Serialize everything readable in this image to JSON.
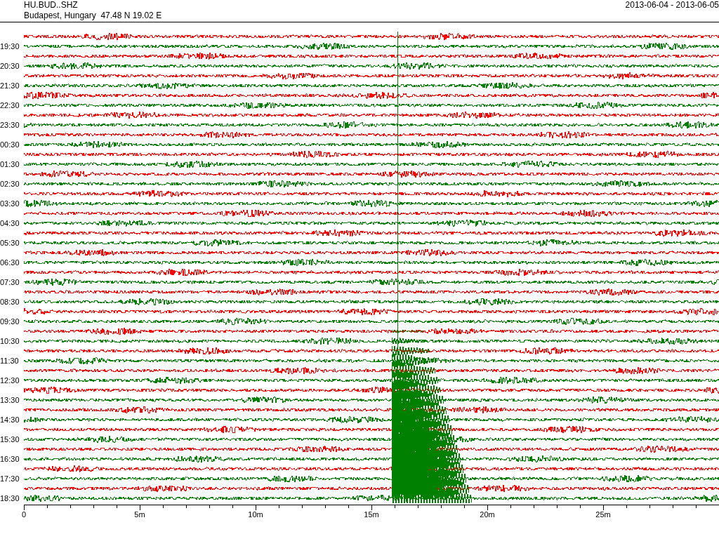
{
  "header": {
    "station": "HU.BUD..SHZ",
    "location": "Budapest, Hungary  47.48 N 19.02 E",
    "date_range": "2013-06-04 - 2013-06-05"
  },
  "traces": [
    {
      "color": "#ff0000"
    },
    {
      "label": "19:30",
      "color": "#008000"
    },
    {
      "color": "#ff0000"
    },
    {
      "label": "20:30",
      "color": "#008000"
    },
    {
      "color": "#ff0000"
    },
    {
      "label": "21:30",
      "color": "#008000"
    },
    {
      "color": "#ff0000"
    },
    {
      "label": "22:30",
      "color": "#008000"
    },
    {
      "color": "#ff0000"
    },
    {
      "label": "23:30",
      "color": "#008000"
    },
    {
      "color": "#ff0000"
    },
    {
      "label": "00:30",
      "color": "#008000"
    },
    {
      "color": "#ff0000"
    },
    {
      "label": "01:30",
      "color": "#008000"
    },
    {
      "color": "#ff0000"
    },
    {
      "label": "02:30",
      "color": "#008000"
    },
    {
      "color": "#ff0000"
    },
    {
      "label": "03:30",
      "color": "#008000"
    },
    {
      "color": "#ff0000"
    },
    {
      "label": "04:30",
      "color": "#008000"
    },
    {
      "color": "#ff0000"
    },
    {
      "label": "05:30",
      "color": "#008000"
    },
    {
      "color": "#ff0000"
    },
    {
      "label": "06:30",
      "color": "#008000"
    },
    {
      "color": "#ff0000"
    },
    {
      "label": "07:30",
      "color": "#008000"
    },
    {
      "color": "#ff0000"
    },
    {
      "label": "08:30",
      "color": "#008000"
    },
    {
      "color": "#ff0000"
    },
    {
      "label": "09:30",
      "color": "#008000"
    },
    {
      "color": "#ff0000"
    },
    {
      "label": "10:30",
      "color": "#008000"
    },
    {
      "color": "#ff0000"
    },
    {
      "label": "11:30",
      "color": "#008000"
    },
    {
      "color": "#ff0000"
    },
    {
      "label": "12:30",
      "color": "#008000"
    },
    {
      "color": "#ff0000"
    },
    {
      "label": "13:30",
      "color": "#008000"
    },
    {
      "color": "#ff0000"
    },
    {
      "label": "14:30",
      "color": "#008000"
    },
    {
      "color": "#ff0000"
    },
    {
      "label": "15:30",
      "color": "#008000"
    },
    {
      "color": "#ff0000"
    },
    {
      "label": "16:30",
      "color": "#008000"
    },
    {
      "color": "#ff0000"
    },
    {
      "label": "17:30",
      "color": "#008000"
    },
    {
      "color": "#ff0000"
    },
    {
      "label": "18:30",
      "color": "#008000"
    }
  ],
  "time_axis": [
    "0",
    "5m",
    "10m",
    "15m",
    "20m",
    "25m"
  ]
}
